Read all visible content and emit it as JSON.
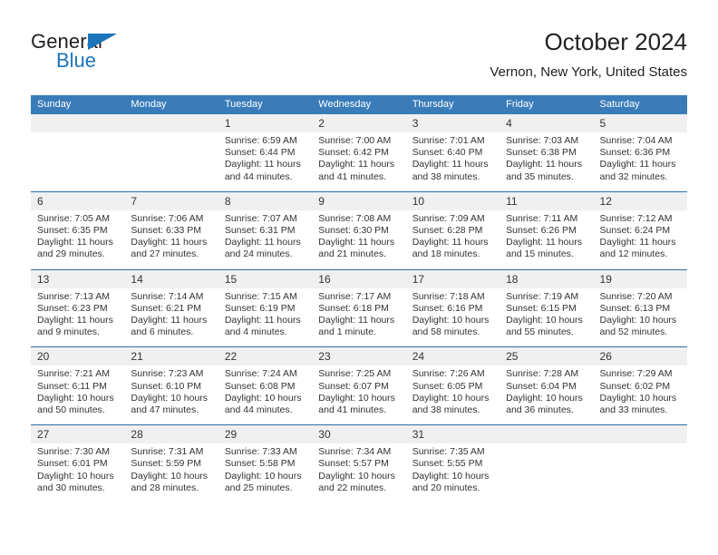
{
  "brand": {
    "name_part1": "General",
    "name_part2": "Blue"
  },
  "header": {
    "title": "October 2024",
    "subtitle": "Vernon, New York, United States"
  },
  "colors": {
    "header_blue": "#3a7cba",
    "brand_blue": "#1b75bb",
    "daynum_band": "#f0f0f0",
    "row_divider": "#2f6ca6",
    "text": "#333333"
  },
  "weekday_headers": [
    "Sunday",
    "Monday",
    "Tuesday",
    "Wednesday",
    "Thursday",
    "Friday",
    "Saturday"
  ],
  "weeks": [
    {
      "days": [
        {
          "num": "",
          "sunrise": "",
          "sunset": "",
          "daylight1": "",
          "daylight2": ""
        },
        {
          "num": "",
          "sunrise": "",
          "sunset": "",
          "daylight1": "",
          "daylight2": ""
        },
        {
          "num": "1",
          "sunrise": "Sunrise: 6:59 AM",
          "sunset": "Sunset: 6:44 PM",
          "daylight1": "Daylight: 11 hours",
          "daylight2": "and 44 minutes."
        },
        {
          "num": "2",
          "sunrise": "Sunrise: 7:00 AM",
          "sunset": "Sunset: 6:42 PM",
          "daylight1": "Daylight: 11 hours",
          "daylight2": "and 41 minutes."
        },
        {
          "num": "3",
          "sunrise": "Sunrise: 7:01 AM",
          "sunset": "Sunset: 6:40 PM",
          "daylight1": "Daylight: 11 hours",
          "daylight2": "and 38 minutes."
        },
        {
          "num": "4",
          "sunrise": "Sunrise: 7:03 AM",
          "sunset": "Sunset: 6:38 PM",
          "daylight1": "Daylight: 11 hours",
          "daylight2": "and 35 minutes."
        },
        {
          "num": "5",
          "sunrise": "Sunrise: 7:04 AM",
          "sunset": "Sunset: 6:36 PM",
          "daylight1": "Daylight: 11 hours",
          "daylight2": "and 32 minutes."
        }
      ]
    },
    {
      "days": [
        {
          "num": "6",
          "sunrise": "Sunrise: 7:05 AM",
          "sunset": "Sunset: 6:35 PM",
          "daylight1": "Daylight: 11 hours",
          "daylight2": "and 29 minutes."
        },
        {
          "num": "7",
          "sunrise": "Sunrise: 7:06 AM",
          "sunset": "Sunset: 6:33 PM",
          "daylight1": "Daylight: 11 hours",
          "daylight2": "and 27 minutes."
        },
        {
          "num": "8",
          "sunrise": "Sunrise: 7:07 AM",
          "sunset": "Sunset: 6:31 PM",
          "daylight1": "Daylight: 11 hours",
          "daylight2": "and 24 minutes."
        },
        {
          "num": "9",
          "sunrise": "Sunrise: 7:08 AM",
          "sunset": "Sunset: 6:30 PM",
          "daylight1": "Daylight: 11 hours",
          "daylight2": "and 21 minutes."
        },
        {
          "num": "10",
          "sunrise": "Sunrise: 7:09 AM",
          "sunset": "Sunset: 6:28 PM",
          "daylight1": "Daylight: 11 hours",
          "daylight2": "and 18 minutes."
        },
        {
          "num": "11",
          "sunrise": "Sunrise: 7:11 AM",
          "sunset": "Sunset: 6:26 PM",
          "daylight1": "Daylight: 11 hours",
          "daylight2": "and 15 minutes."
        },
        {
          "num": "12",
          "sunrise": "Sunrise: 7:12 AM",
          "sunset": "Sunset: 6:24 PM",
          "daylight1": "Daylight: 11 hours",
          "daylight2": "and 12 minutes."
        }
      ]
    },
    {
      "days": [
        {
          "num": "13",
          "sunrise": "Sunrise: 7:13 AM",
          "sunset": "Sunset: 6:23 PM",
          "daylight1": "Daylight: 11 hours",
          "daylight2": "and 9 minutes."
        },
        {
          "num": "14",
          "sunrise": "Sunrise: 7:14 AM",
          "sunset": "Sunset: 6:21 PM",
          "daylight1": "Daylight: 11 hours",
          "daylight2": "and 6 minutes."
        },
        {
          "num": "15",
          "sunrise": "Sunrise: 7:15 AM",
          "sunset": "Sunset: 6:19 PM",
          "daylight1": "Daylight: 11 hours",
          "daylight2": "and 4 minutes."
        },
        {
          "num": "16",
          "sunrise": "Sunrise: 7:17 AM",
          "sunset": "Sunset: 6:18 PM",
          "daylight1": "Daylight: 11 hours",
          "daylight2": "and 1 minute."
        },
        {
          "num": "17",
          "sunrise": "Sunrise: 7:18 AM",
          "sunset": "Sunset: 6:16 PM",
          "daylight1": "Daylight: 10 hours",
          "daylight2": "and 58 minutes."
        },
        {
          "num": "18",
          "sunrise": "Sunrise: 7:19 AM",
          "sunset": "Sunset: 6:15 PM",
          "daylight1": "Daylight: 10 hours",
          "daylight2": "and 55 minutes."
        },
        {
          "num": "19",
          "sunrise": "Sunrise: 7:20 AM",
          "sunset": "Sunset: 6:13 PM",
          "daylight1": "Daylight: 10 hours",
          "daylight2": "and 52 minutes."
        }
      ]
    },
    {
      "days": [
        {
          "num": "20",
          "sunrise": "Sunrise: 7:21 AM",
          "sunset": "Sunset: 6:11 PM",
          "daylight1": "Daylight: 10 hours",
          "daylight2": "and 50 minutes."
        },
        {
          "num": "21",
          "sunrise": "Sunrise: 7:23 AM",
          "sunset": "Sunset: 6:10 PM",
          "daylight1": "Daylight: 10 hours",
          "daylight2": "and 47 minutes."
        },
        {
          "num": "22",
          "sunrise": "Sunrise: 7:24 AM",
          "sunset": "Sunset: 6:08 PM",
          "daylight1": "Daylight: 10 hours",
          "daylight2": "and 44 minutes."
        },
        {
          "num": "23",
          "sunrise": "Sunrise: 7:25 AM",
          "sunset": "Sunset: 6:07 PM",
          "daylight1": "Daylight: 10 hours",
          "daylight2": "and 41 minutes."
        },
        {
          "num": "24",
          "sunrise": "Sunrise: 7:26 AM",
          "sunset": "Sunset: 6:05 PM",
          "daylight1": "Daylight: 10 hours",
          "daylight2": "and 38 minutes."
        },
        {
          "num": "25",
          "sunrise": "Sunrise: 7:28 AM",
          "sunset": "Sunset: 6:04 PM",
          "daylight1": "Daylight: 10 hours",
          "daylight2": "and 36 minutes."
        },
        {
          "num": "26",
          "sunrise": "Sunrise: 7:29 AM",
          "sunset": "Sunset: 6:02 PM",
          "daylight1": "Daylight: 10 hours",
          "daylight2": "and 33 minutes."
        }
      ]
    },
    {
      "days": [
        {
          "num": "27",
          "sunrise": "Sunrise: 7:30 AM",
          "sunset": "Sunset: 6:01 PM",
          "daylight1": "Daylight: 10 hours",
          "daylight2": "and 30 minutes."
        },
        {
          "num": "28",
          "sunrise": "Sunrise: 7:31 AM",
          "sunset": "Sunset: 5:59 PM",
          "daylight1": "Daylight: 10 hours",
          "daylight2": "and 28 minutes."
        },
        {
          "num": "29",
          "sunrise": "Sunrise: 7:33 AM",
          "sunset": "Sunset: 5:58 PM",
          "daylight1": "Daylight: 10 hours",
          "daylight2": "and 25 minutes."
        },
        {
          "num": "30",
          "sunrise": "Sunrise: 7:34 AM",
          "sunset": "Sunset: 5:57 PM",
          "daylight1": "Daylight: 10 hours",
          "daylight2": "and 22 minutes."
        },
        {
          "num": "31",
          "sunrise": "Sunrise: 7:35 AM",
          "sunset": "Sunset: 5:55 PM",
          "daylight1": "Daylight: 10 hours",
          "daylight2": "and 20 minutes."
        },
        {
          "num": "",
          "sunrise": "",
          "sunset": "",
          "daylight1": "",
          "daylight2": ""
        },
        {
          "num": "",
          "sunrise": "",
          "sunset": "",
          "daylight1": "",
          "daylight2": ""
        }
      ]
    }
  ]
}
